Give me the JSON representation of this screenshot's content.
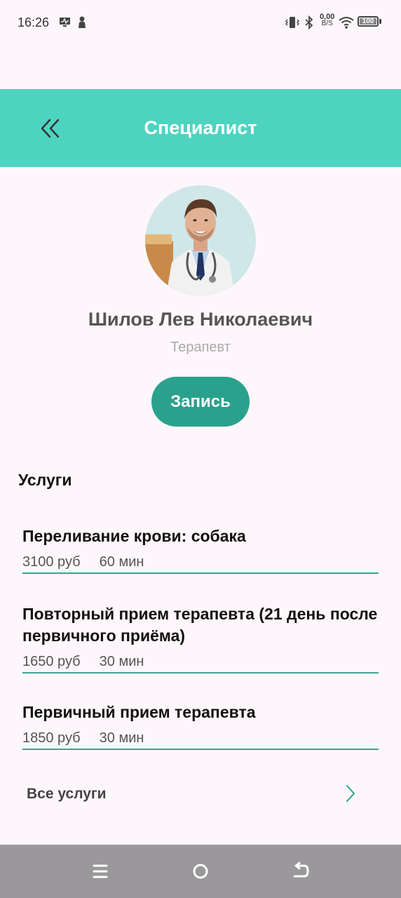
{
  "status_bar": {
    "time": "16:26",
    "speed_value": "0,00",
    "speed_unit": "B/S",
    "battery": "100"
  },
  "header": {
    "title": "Специалист",
    "back_icon": "double-chevron-left-icon"
  },
  "colors": {
    "header_bg": "#4dd4c0",
    "accent": "#2aa18c",
    "divider": "#3ba592",
    "background": "#fdf7fc",
    "navbar_bg": "#9a989a"
  },
  "doctor": {
    "name": "Шилов Лев Николаевич",
    "specialty": "Терапевт"
  },
  "book_button": {
    "label": "Запись"
  },
  "services": {
    "title": "Услуги",
    "items": [
      {
        "name": "Переливание крови: собака",
        "price": "3100 руб",
        "duration": "60 мин"
      },
      {
        "name": "Повторный прием терапевта (21 день после первичного приёма)",
        "price": "1650 руб",
        "duration": "30 мин"
      },
      {
        "name": "Первичный прием терапевта",
        "price": "1850 руб",
        "duration": "30 мин"
      }
    ],
    "all_label": "Все услуги"
  },
  "navbar": {
    "buttons": [
      "menu-icon",
      "home-circle-icon",
      "back-arrow-icon"
    ]
  }
}
